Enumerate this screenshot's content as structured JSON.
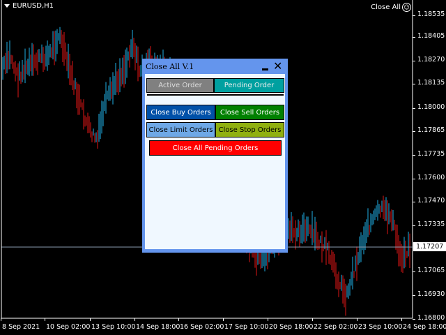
{
  "chart": {
    "symbol": "EURUSD,H1",
    "close_all_label": "Close All",
    "price_labels": [
      "1.18535",
      "1.18405",
      "1.18270",
      "1.18135",
      "1.18000",
      "1.17865",
      "1.17735",
      "1.17600",
      "1.17470",
      "1.17335",
      "1.17065",
      "1.16930",
      "1.16800"
    ],
    "current_price": "1.17207",
    "time_labels": [
      "8 Sep 2021",
      "10 Sep 02:00",
      "13 Sep 10:00",
      "14 Sep 18:00",
      "16 Sep 02:00",
      "17 Sep 10:00",
      "20 Sep 18:00",
      "22 Sep 02:00",
      "23 Sep 10:00",
      "24 Sep 18:00"
    ],
    "colors": {
      "bull": "#1fb0e6",
      "bear": "#e01616",
      "background": "#000000"
    }
  },
  "dialog": {
    "title": "Close All V.1",
    "tabs": {
      "active": "Active Order",
      "pending": "Pending Order"
    },
    "buttons": {
      "close_buy": "Close Buy Orders",
      "close_sell": "Close Sell Orders",
      "close_limit": "Close Limit Orders",
      "close_stop": "Close Stop Orders",
      "close_all_pending": "Close All Pending Orders"
    },
    "colors": {
      "titlebar": "#6495ed",
      "body": "#f0f8ff",
      "active_tab": "#808080",
      "pending_tab": "#00a0a0",
      "buy": "#0050a8",
      "sell": "#008000",
      "limit": "#6ea8e6",
      "stop": "#90b010",
      "all_pending": "#ff0000"
    }
  }
}
